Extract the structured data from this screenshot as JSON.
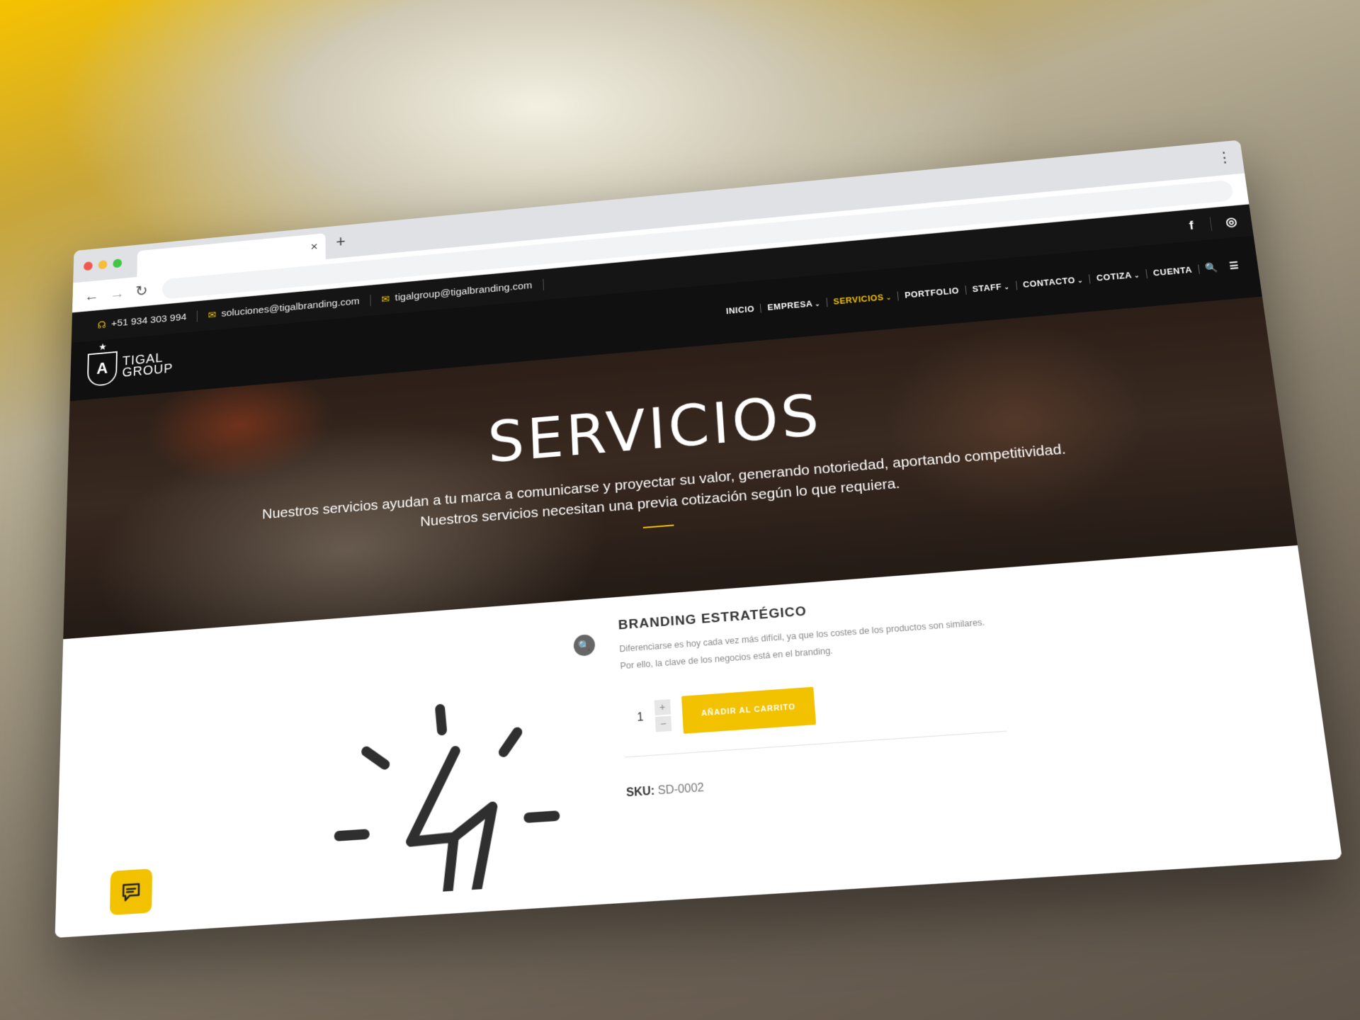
{
  "browser": {
    "tab_close": "×",
    "new_tab": "+",
    "menu": "⋮",
    "back": "←",
    "forward": "→",
    "reload": "↻"
  },
  "topbar": {
    "phone": "+51 934 303 994",
    "email1": "soluciones@tigalbranding.com",
    "email2": "tigalgroup@tigalbranding.com",
    "social": [
      "f",
      "◎"
    ]
  },
  "logo": {
    "mark": "A",
    "line1": "TIGAL",
    "line2": "GROUP"
  },
  "nav": {
    "items": [
      {
        "label": "INICIO",
        "chev": false,
        "active": false
      },
      {
        "label": "EMPRESA",
        "chev": true,
        "active": false
      },
      {
        "label": "SERVICIOS",
        "chev": true,
        "active": true
      },
      {
        "label": "PORTFOLIO",
        "chev": false,
        "active": false
      },
      {
        "label": "STAFF",
        "chev": true,
        "active": false
      },
      {
        "label": "CONTACTO",
        "chev": true,
        "active": false
      },
      {
        "label": "COTIZA",
        "chev": true,
        "active": false
      },
      {
        "label": "CUENTA",
        "chev": false,
        "active": false
      }
    ],
    "chevron": "⌄",
    "search_icon": "🔍",
    "menu_icon": "☰"
  },
  "hero": {
    "title": "SERVICIOS",
    "subtitle1": "Nuestros servicios ayudan a tu marca a comunicarse y proyectar su valor, generando notoriedad, aportando competitividad.",
    "subtitle2": "Nuestros servicios necesitan una previa cotización según lo que requiera."
  },
  "product": {
    "title": "BRANDING ESTRATÉGICO",
    "desc1": "Diferenciarse es hoy cada vez más difícil, ya que los costes de los productos son similares.",
    "desc2": "Por ello, la clave de los negocios está en el branding.",
    "quantity": "1",
    "plus": "+",
    "minus": "−",
    "add_to_cart": "AÑADIR AL CARRITO",
    "sku_label": "SKU:",
    "sku_value": "SD-0002"
  },
  "colors": {
    "accent": "#f2c200",
    "dark": "#151515"
  }
}
